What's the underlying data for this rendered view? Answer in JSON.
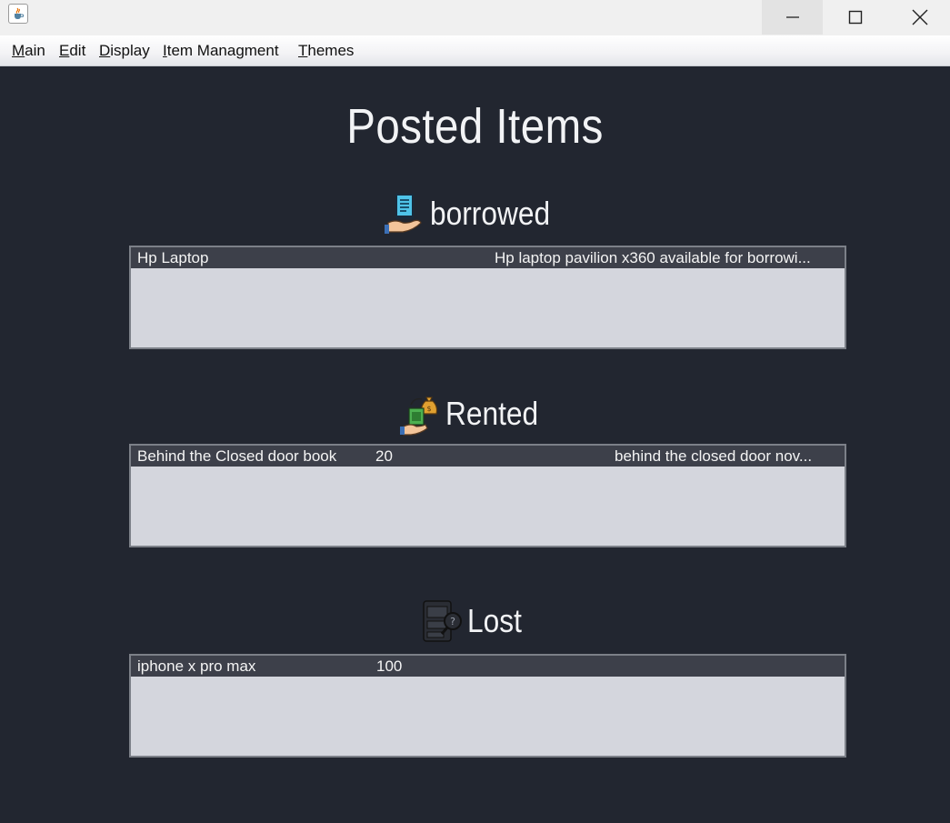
{
  "window": {
    "minimize_icon": "minimize-icon",
    "maximize_icon": "maximize-icon",
    "close_icon": "close-icon",
    "app_icon": "java-cup-icon"
  },
  "menu": {
    "items": [
      {
        "mnemonic": "M",
        "rest": "ain"
      },
      {
        "mnemonic": "E",
        "rest": "dit"
      },
      {
        "mnemonic": "D",
        "rest": "isplay"
      },
      {
        "mnemonic": "I",
        "rest": "tem Managment"
      },
      {
        "mnemonic": "T",
        "rest": "hemes"
      }
    ]
  },
  "page": {
    "title": "Posted Items"
  },
  "sections": {
    "borrowed": {
      "label": "borrowed",
      "icon": "hand-holding-phone-icon",
      "rows": [
        {
          "name": "Hp Laptop",
          "price": "",
          "description": "Hp laptop pavilion x360 available for borrowi..."
        }
      ]
    },
    "rented": {
      "label": "Rented",
      "icon": "money-bag-exchange-icon",
      "rows": [
        {
          "name": "Behind the Closed door book",
          "price": "20",
          "description": "behind the closed door nov..."
        }
      ]
    },
    "lost": {
      "label": "Lost",
      "icon": "lost-devices-search-icon",
      "rows": [
        {
          "name": "iphone x pro max",
          "price": "100",
          "description": ""
        }
      ]
    }
  },
  "colors": {
    "background": "#222630",
    "row_background": "#3d404a",
    "table_background": "#d4d6dd",
    "text_light": "#f2f3f5"
  }
}
